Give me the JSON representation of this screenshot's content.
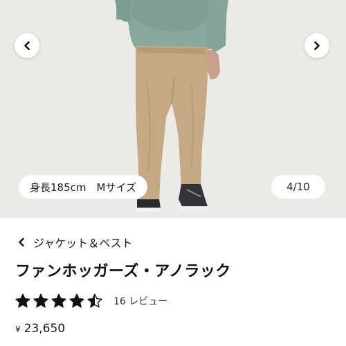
{
  "carousel": {
    "caption": "身長185cm　Mサイズ",
    "counter": "4/10",
    "prev_icon": "chevron-left-icon",
    "next_icon": "chevron-right-icon"
  },
  "breadcrumb": {
    "label": "ジャケット＆ベスト",
    "icon": "chevron-left-icon"
  },
  "product": {
    "title": "ファンホッガーズ・アノラック",
    "rating": {
      "value": 4.5,
      "max": 5,
      "review_label": "16 レビュー"
    },
    "price": {
      "currency": "¥",
      "amount": "23,650"
    }
  },
  "colors": {
    "jacket": "#88a89f",
    "pants": "#c4a983",
    "background": "#ebeae6"
  }
}
